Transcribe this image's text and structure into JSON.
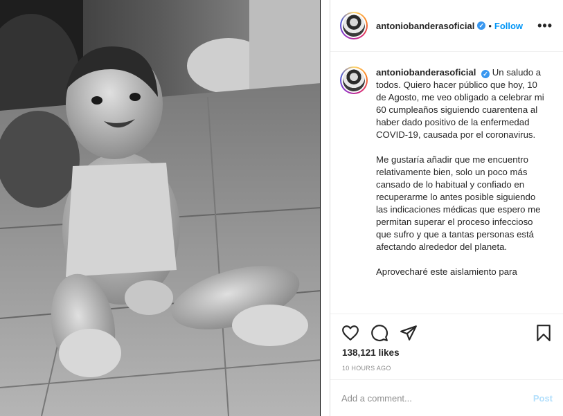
{
  "post": {
    "image_alt": "Black and white photo of a smiling baby sitting on a tiled patio",
    "header": {
      "username": "antoniobanderasoficial",
      "verified_icon": "verified-badge-icon",
      "separator": "•",
      "follow_label": "Follow",
      "more_icon": "more-options-icon",
      "more_label": "•••"
    },
    "caption": {
      "username": "antoniobanderasoficial",
      "paragraphs": [
        "Un saludo a todos. Quiero hacer público que hoy, 10 de Agosto, me veo obligado a celebrar mi 60 cumpleaños siguiendo cuarentena al haber dado positivo de la enfermedad COVID-19, causada por el coronavirus.",
        "Me gustaría añadir que me encuentro relativamente bien, solo un poco más cansado de lo habitual y confiado en recuperarme lo antes posible siguiendo las indicaciones médicas que espero me permitan superar el proceso infeccioso que sufro y que a tantas personas está afectando alrededor del planeta.",
        "Aprovecharé este aislamiento para"
      ]
    },
    "actions": {
      "like_icon": "heart-icon",
      "comment_icon": "comment-icon",
      "share_icon": "share-icon",
      "save_icon": "bookmark-icon"
    },
    "likes": "138,121 likes",
    "timestamp": "10 HOURS AGO",
    "comment": {
      "placeholder": "Add a comment...",
      "post_label": "Post"
    }
  },
  "colors": {
    "link_blue": "#0095f6",
    "post_disabled": "#b2dffc",
    "verified": "#3897f0",
    "muted": "#8e8e8e"
  }
}
